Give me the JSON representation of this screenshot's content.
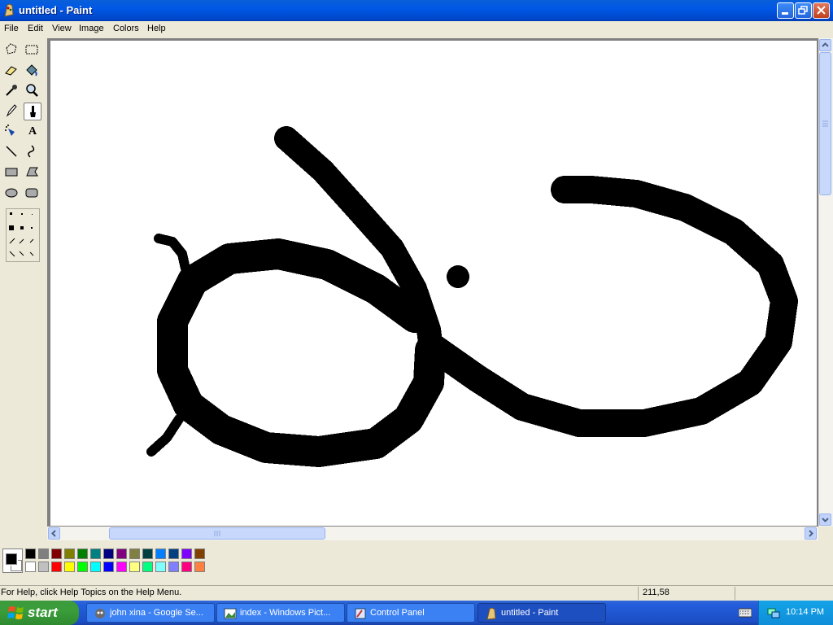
{
  "window": {
    "title": "untitled - Paint",
    "app_icon": "paint-icon",
    "controls": [
      "minimize",
      "maximize",
      "close"
    ]
  },
  "menu": [
    "File",
    "Edit",
    "View",
    "Image",
    "Colors",
    "Help"
  ],
  "tools": [
    {
      "name": "free-form-select",
      "icon": "free-select-icon"
    },
    {
      "name": "select",
      "icon": "rect-select-icon"
    },
    {
      "name": "eraser",
      "icon": "eraser-icon"
    },
    {
      "name": "fill",
      "icon": "fill-bucket-icon"
    },
    {
      "name": "pick-color",
      "icon": "eyedropper-icon"
    },
    {
      "name": "magnifier",
      "icon": "magnifier-icon"
    },
    {
      "name": "pencil",
      "icon": "pencil-icon"
    },
    {
      "name": "brush",
      "icon": "brush-icon",
      "selected": true
    },
    {
      "name": "airbrush",
      "icon": "airbrush-icon"
    },
    {
      "name": "text",
      "icon": "text-icon",
      "glyph": "A"
    },
    {
      "name": "line",
      "icon": "line-icon"
    },
    {
      "name": "curve",
      "icon": "curve-icon"
    },
    {
      "name": "rectangle",
      "icon": "rectangle-icon"
    },
    {
      "name": "polygon",
      "icon": "polygon-icon"
    },
    {
      "name": "ellipse",
      "icon": "ellipse-icon"
    },
    {
      "name": "rounded-rectangle",
      "icon": "rounded-rect-icon"
    }
  ],
  "palette": {
    "foreground": "#000000",
    "background": "#ffffff",
    "row1": [
      "#000000",
      "#808080",
      "#800000",
      "#808000",
      "#008000",
      "#008080",
      "#000080",
      "#800080",
      "#808040",
      "#004040",
      "#0080ff",
      "#004080",
      "#8000ff",
      "#804000"
    ],
    "row2": [
      "#ffffff",
      "#c0c0c0",
      "#ff0000",
      "#ffff00",
      "#00ff00",
      "#00ffff",
      "#0000ff",
      "#ff00ff",
      "#ffff80",
      "#00ff80",
      "#80ffff",
      "#8080ff",
      "#ff0080",
      "#ff8040"
    ]
  },
  "status": {
    "help_text": "For Help, click Help Topics on the Help Menu.",
    "coords": "211,58"
  },
  "taskbar": {
    "start_label": "start",
    "tasks": [
      {
        "label": "john xina - Google Se...",
        "icon": "browser-icon",
        "active": false
      },
      {
        "label": "index - Windows Pict...",
        "icon": "picture-viewer-icon",
        "active": false
      },
      {
        "label": "Control Panel",
        "icon": "control-panel-icon",
        "active": false
      },
      {
        "label": "untitled - Paint",
        "icon": "paint-icon",
        "active": true
      }
    ],
    "clock": "10:14 PM"
  }
}
